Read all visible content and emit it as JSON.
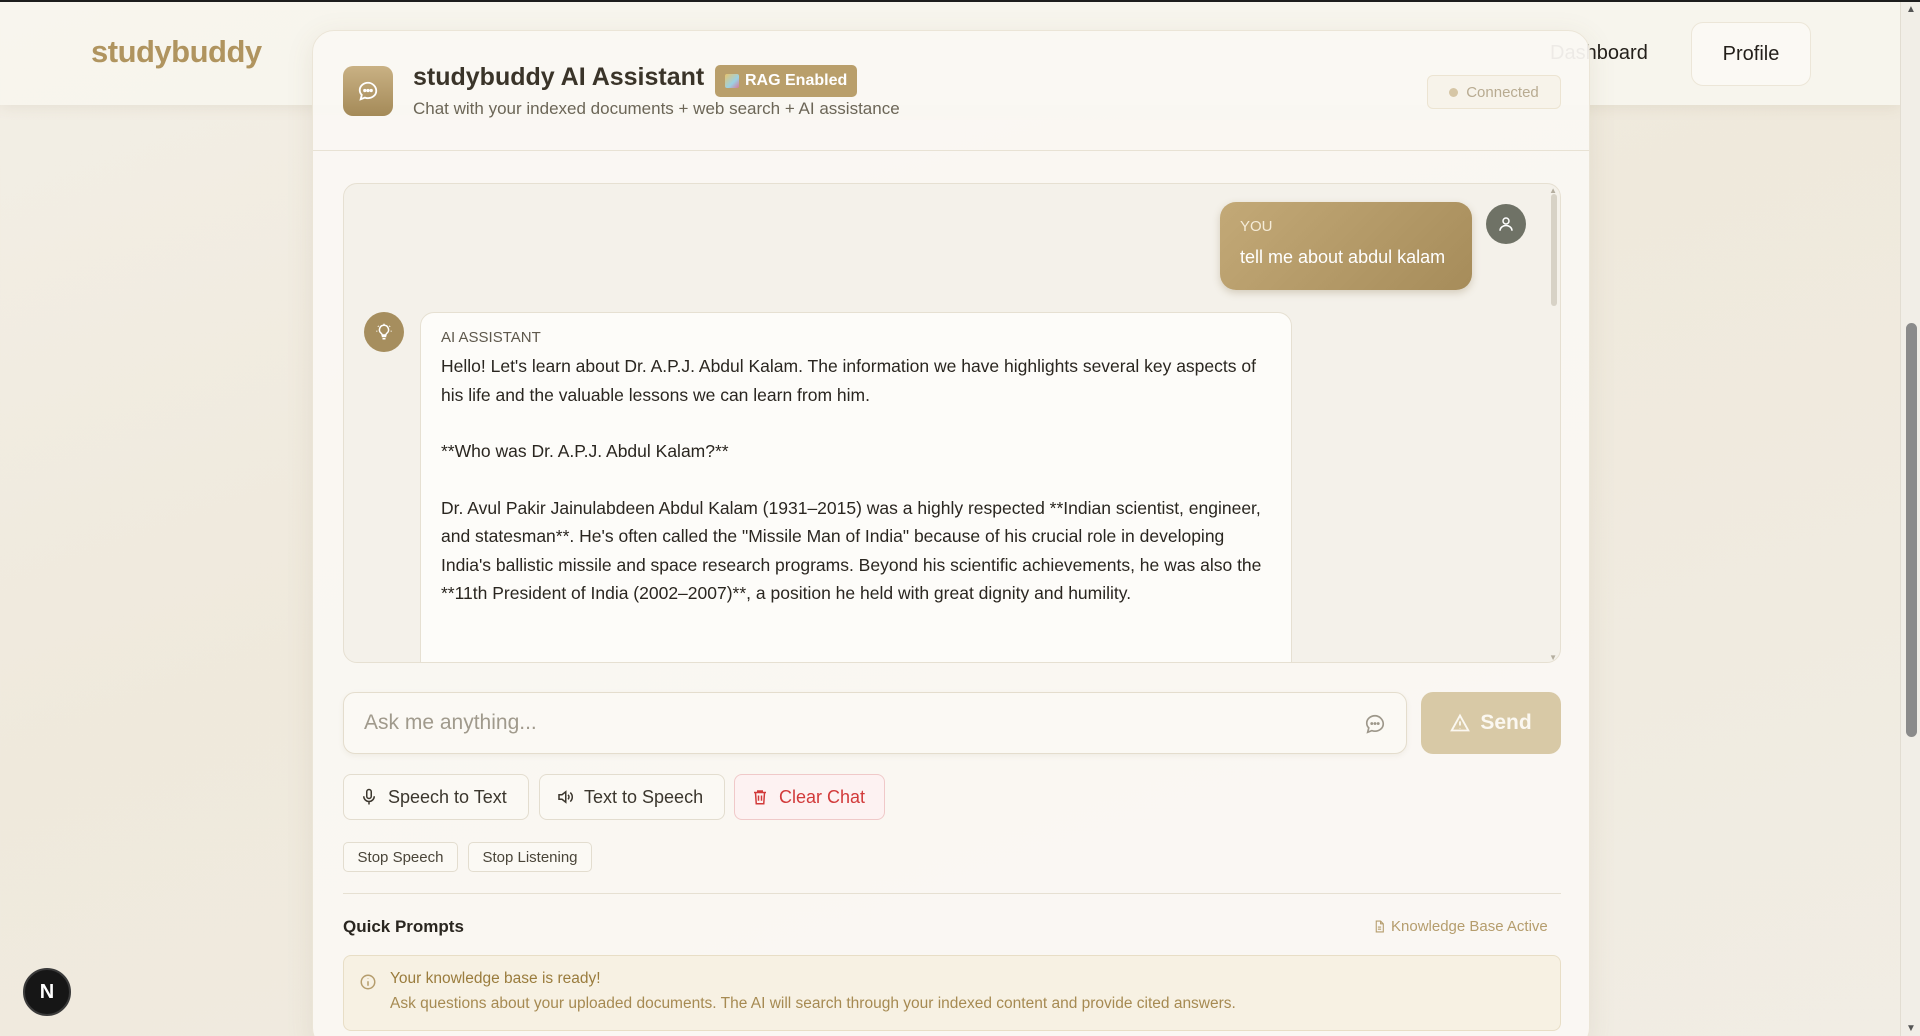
{
  "nav": {
    "brand": "studybuddy",
    "dashboard": "Dashboard",
    "profile": "Profile"
  },
  "header": {
    "title": "studybuddy AI Assistant",
    "badge": "RAG Enabled",
    "subtitle": "Chat with your indexed documents + web search + AI assistance",
    "status": "Connected"
  },
  "chat": {
    "messages": [
      {
        "role_label": "YOU",
        "text": "tell me about abdul kalam"
      },
      {
        "role_label": "AI ASSISTANT",
        "paragraphs": [
          "Hello!  Let's learn about Dr. A.P.J. Abdul Kalam.  The information we have highlights several key aspects of his life and the valuable lessons we can learn from him.",
          "**Who was Dr. A.P.J. Abdul Kalam?**",
          "Dr. Avul Pakir Jainulabdeen Abdul Kalam (1931–2015) was a highly respected **Indian scientist, engineer, and statesman**.  He's often called the \"Missile Man of India\" because of his crucial role in developing India's ballistic missile and space research programs.  Beyond his scientific achievements, he was also the **11th President of India (2002–2007)**, a position he held with great dignity and humility."
        ]
      }
    ]
  },
  "input": {
    "placeholder": "Ask me anything...",
    "value": "",
    "send_label": "Send"
  },
  "tools": {
    "speech_to_text": "Speech to Text",
    "text_to_speech": "Text to Speech",
    "clear_chat": "Clear Chat",
    "stop_speech": "Stop Speech",
    "stop_listening": "Stop Listening"
  },
  "quick_prompts": {
    "title": "Quick Prompts",
    "kb_status": "Knowledge Base Active",
    "notice_title": "Your knowledge base is ready!",
    "notice_text": "Ask questions about your uploaded documents. The AI will search through your indexed content and provide cited answers."
  },
  "devtools_badge": "N",
  "colors": {
    "brand": "#b0945f",
    "accent": "#a68c5a",
    "danger": "#d23a3a",
    "send_disabled": "#d8c9a6"
  },
  "icons": [
    "chat-bubble-icon",
    "user-icon",
    "lightbulb-icon",
    "microphone-icon",
    "speaker-icon",
    "trash-icon",
    "warning-icon",
    "document-icon",
    "info-icon"
  ]
}
